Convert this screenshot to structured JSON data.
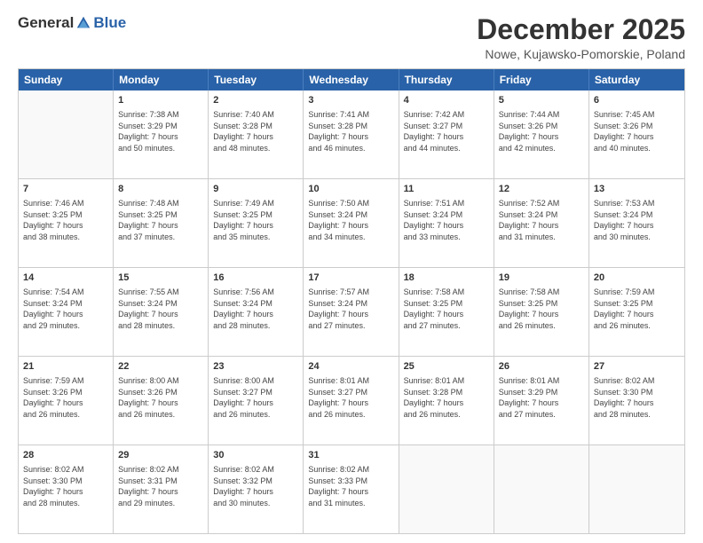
{
  "header": {
    "logo_general": "General",
    "logo_blue": "Blue",
    "month_title": "December 2025",
    "location": "Nowe, Kujawsko-Pomorskie, Poland"
  },
  "weekdays": [
    "Sunday",
    "Monday",
    "Tuesday",
    "Wednesday",
    "Thursday",
    "Friday",
    "Saturday"
  ],
  "rows": [
    [
      {
        "day": "",
        "lines": []
      },
      {
        "day": "1",
        "lines": [
          "Sunrise: 7:38 AM",
          "Sunset: 3:29 PM",
          "Daylight: 7 hours",
          "and 50 minutes."
        ]
      },
      {
        "day": "2",
        "lines": [
          "Sunrise: 7:40 AM",
          "Sunset: 3:28 PM",
          "Daylight: 7 hours",
          "and 48 minutes."
        ]
      },
      {
        "day": "3",
        "lines": [
          "Sunrise: 7:41 AM",
          "Sunset: 3:28 PM",
          "Daylight: 7 hours",
          "and 46 minutes."
        ]
      },
      {
        "day": "4",
        "lines": [
          "Sunrise: 7:42 AM",
          "Sunset: 3:27 PM",
          "Daylight: 7 hours",
          "and 44 minutes."
        ]
      },
      {
        "day": "5",
        "lines": [
          "Sunrise: 7:44 AM",
          "Sunset: 3:26 PM",
          "Daylight: 7 hours",
          "and 42 minutes."
        ]
      },
      {
        "day": "6",
        "lines": [
          "Sunrise: 7:45 AM",
          "Sunset: 3:26 PM",
          "Daylight: 7 hours",
          "and 40 minutes."
        ]
      }
    ],
    [
      {
        "day": "7",
        "lines": [
          "Sunrise: 7:46 AM",
          "Sunset: 3:25 PM",
          "Daylight: 7 hours",
          "and 38 minutes."
        ]
      },
      {
        "day": "8",
        "lines": [
          "Sunrise: 7:48 AM",
          "Sunset: 3:25 PM",
          "Daylight: 7 hours",
          "and 37 minutes."
        ]
      },
      {
        "day": "9",
        "lines": [
          "Sunrise: 7:49 AM",
          "Sunset: 3:25 PM",
          "Daylight: 7 hours",
          "and 35 minutes."
        ]
      },
      {
        "day": "10",
        "lines": [
          "Sunrise: 7:50 AM",
          "Sunset: 3:24 PM",
          "Daylight: 7 hours",
          "and 34 minutes."
        ]
      },
      {
        "day": "11",
        "lines": [
          "Sunrise: 7:51 AM",
          "Sunset: 3:24 PM",
          "Daylight: 7 hours",
          "and 33 minutes."
        ]
      },
      {
        "day": "12",
        "lines": [
          "Sunrise: 7:52 AM",
          "Sunset: 3:24 PM",
          "Daylight: 7 hours",
          "and 31 minutes."
        ]
      },
      {
        "day": "13",
        "lines": [
          "Sunrise: 7:53 AM",
          "Sunset: 3:24 PM",
          "Daylight: 7 hours",
          "and 30 minutes."
        ]
      }
    ],
    [
      {
        "day": "14",
        "lines": [
          "Sunrise: 7:54 AM",
          "Sunset: 3:24 PM",
          "Daylight: 7 hours",
          "and 29 minutes."
        ]
      },
      {
        "day": "15",
        "lines": [
          "Sunrise: 7:55 AM",
          "Sunset: 3:24 PM",
          "Daylight: 7 hours",
          "and 28 minutes."
        ]
      },
      {
        "day": "16",
        "lines": [
          "Sunrise: 7:56 AM",
          "Sunset: 3:24 PM",
          "Daylight: 7 hours",
          "and 28 minutes."
        ]
      },
      {
        "day": "17",
        "lines": [
          "Sunrise: 7:57 AM",
          "Sunset: 3:24 PM",
          "Daylight: 7 hours",
          "and 27 minutes."
        ]
      },
      {
        "day": "18",
        "lines": [
          "Sunrise: 7:58 AM",
          "Sunset: 3:25 PM",
          "Daylight: 7 hours",
          "and 27 minutes."
        ]
      },
      {
        "day": "19",
        "lines": [
          "Sunrise: 7:58 AM",
          "Sunset: 3:25 PM",
          "Daylight: 7 hours",
          "and 26 minutes."
        ]
      },
      {
        "day": "20",
        "lines": [
          "Sunrise: 7:59 AM",
          "Sunset: 3:25 PM",
          "Daylight: 7 hours",
          "and 26 minutes."
        ]
      }
    ],
    [
      {
        "day": "21",
        "lines": [
          "Sunrise: 7:59 AM",
          "Sunset: 3:26 PM",
          "Daylight: 7 hours",
          "and 26 minutes."
        ]
      },
      {
        "day": "22",
        "lines": [
          "Sunrise: 8:00 AM",
          "Sunset: 3:26 PM",
          "Daylight: 7 hours",
          "and 26 minutes."
        ]
      },
      {
        "day": "23",
        "lines": [
          "Sunrise: 8:00 AM",
          "Sunset: 3:27 PM",
          "Daylight: 7 hours",
          "and 26 minutes."
        ]
      },
      {
        "day": "24",
        "lines": [
          "Sunrise: 8:01 AM",
          "Sunset: 3:27 PM",
          "Daylight: 7 hours",
          "and 26 minutes."
        ]
      },
      {
        "day": "25",
        "lines": [
          "Sunrise: 8:01 AM",
          "Sunset: 3:28 PM",
          "Daylight: 7 hours",
          "and 26 minutes."
        ]
      },
      {
        "day": "26",
        "lines": [
          "Sunrise: 8:01 AM",
          "Sunset: 3:29 PM",
          "Daylight: 7 hours",
          "and 27 minutes."
        ]
      },
      {
        "day": "27",
        "lines": [
          "Sunrise: 8:02 AM",
          "Sunset: 3:30 PM",
          "Daylight: 7 hours",
          "and 28 minutes."
        ]
      }
    ],
    [
      {
        "day": "28",
        "lines": [
          "Sunrise: 8:02 AM",
          "Sunset: 3:30 PM",
          "Daylight: 7 hours",
          "and 28 minutes."
        ]
      },
      {
        "day": "29",
        "lines": [
          "Sunrise: 8:02 AM",
          "Sunset: 3:31 PM",
          "Daylight: 7 hours",
          "and 29 minutes."
        ]
      },
      {
        "day": "30",
        "lines": [
          "Sunrise: 8:02 AM",
          "Sunset: 3:32 PM",
          "Daylight: 7 hours",
          "and 30 minutes."
        ]
      },
      {
        "day": "31",
        "lines": [
          "Sunrise: 8:02 AM",
          "Sunset: 3:33 PM",
          "Daylight: 7 hours",
          "and 31 minutes."
        ]
      },
      {
        "day": "",
        "lines": []
      },
      {
        "day": "",
        "lines": []
      },
      {
        "day": "",
        "lines": []
      }
    ]
  ]
}
